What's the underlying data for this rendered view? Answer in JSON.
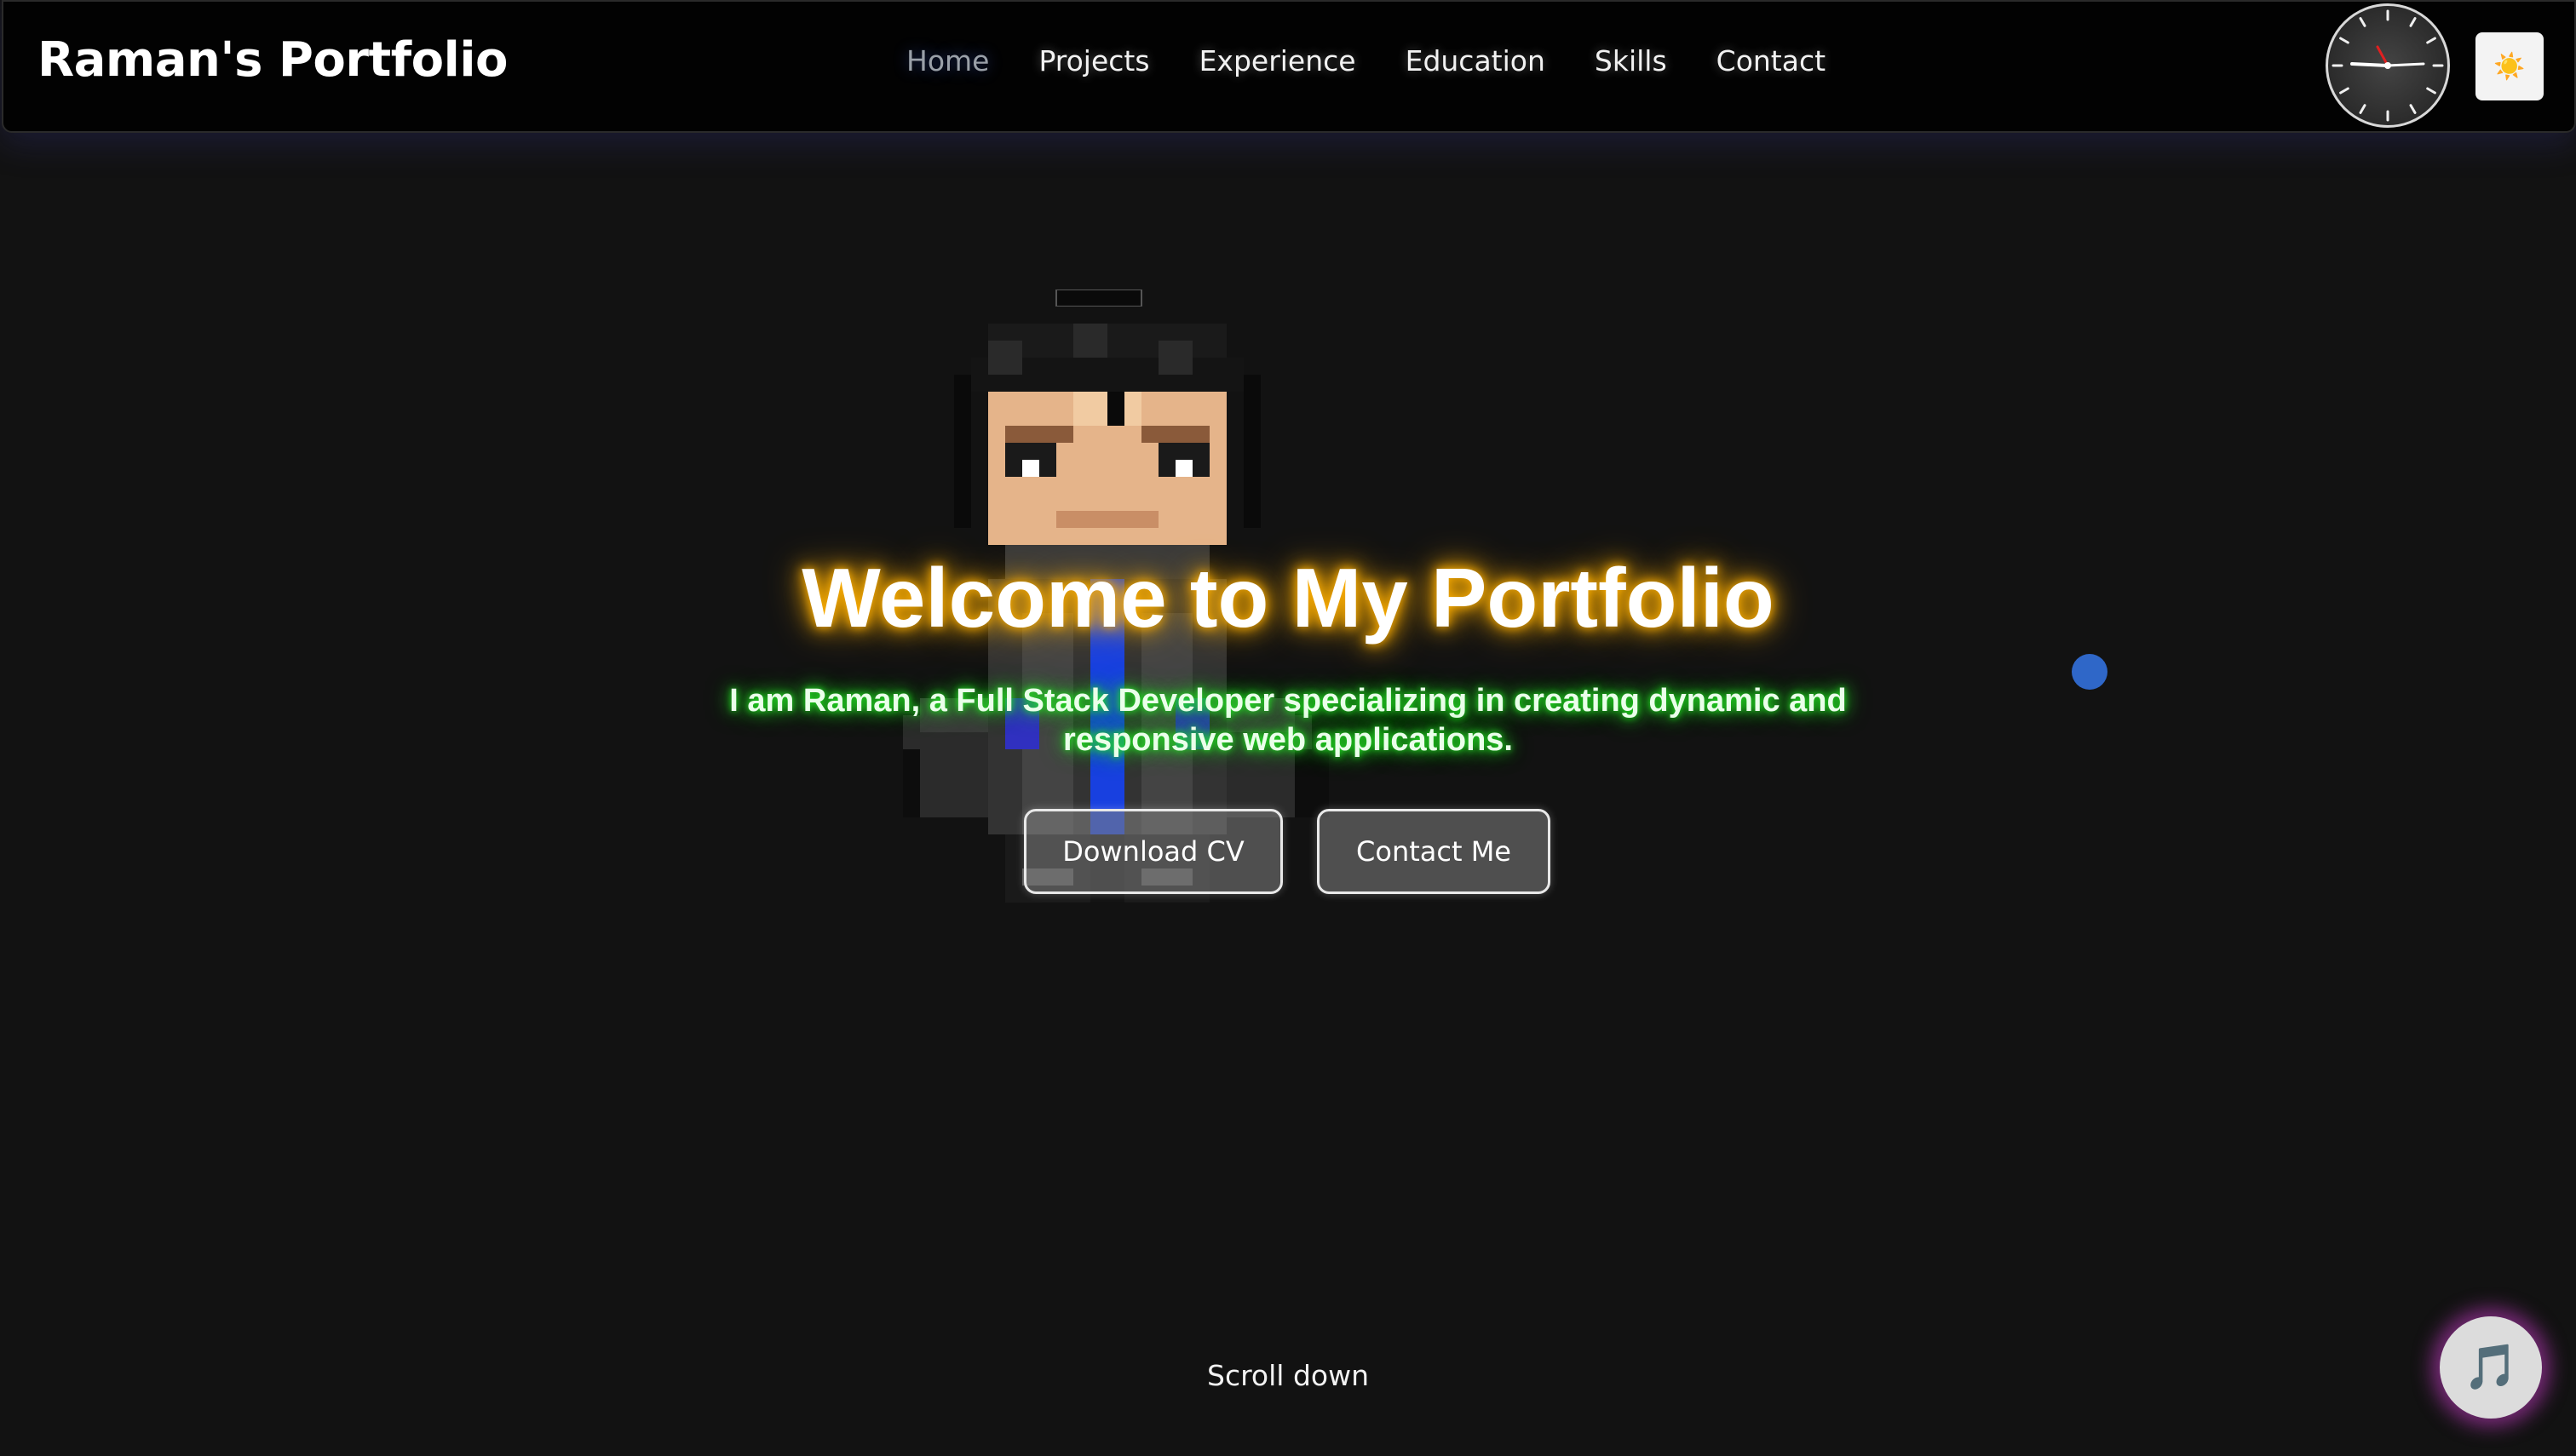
{
  "navbar": {
    "brand": "Raman's Portfolio",
    "links": [
      {
        "label": "Home",
        "active": true
      },
      {
        "label": "Projects"
      },
      {
        "label": "Experience"
      },
      {
        "label": "Education"
      },
      {
        "label": "Skills"
      },
      {
        "label": "Contact"
      }
    ],
    "clock_icon": "analog-clock-icon",
    "theme_toggle_icon": "☀️"
  },
  "hero": {
    "title": "Welcome to My Portfolio",
    "subtitle": "I am Raman, a Full Stack Developer specializing in creating dynamic and responsive web applications.",
    "buttons": {
      "download_cv": "Download CV",
      "contact_me": "Contact Me"
    },
    "avatar_icon": "pixel-art-avatar"
  },
  "scroll_hint": "Scroll down",
  "music_button_icon": "🎵",
  "colors": {
    "title_glow": "#ffb000",
    "subtitle_glow": "#22ee22",
    "music_glow": "#c83cc8",
    "dot": "#2f67c8"
  }
}
